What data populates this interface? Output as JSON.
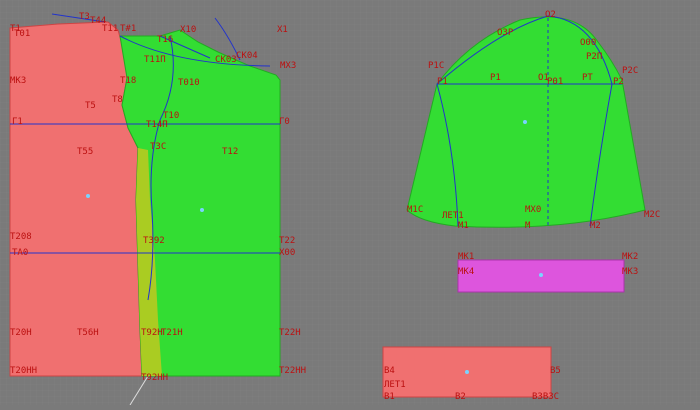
{
  "colors": {
    "background": "#7a7a7a",
    "grid": "#828282",
    "back_piece": "#f07070",
    "front_piece": "#33dd33",
    "front_overlap": "#aacc22",
    "sleeve_piece": "#33dd33",
    "cuff_piece": "#dd55dd",
    "band_piece": "#f07070",
    "construction_line": "#2233cc",
    "label": "#bb1111",
    "marker": "#7ad3ff"
  },
  "labels": {
    "t1": "T1",
    "t3": "T3",
    "t44": "T44",
    "t01": "T01",
    "t11": "T11",
    "x_t1": "T#1",
    "x1": "X1",
    "x10": "X10",
    "t16": "T16",
    "t11p": "T11П",
    "ck04": "CK04",
    "ck03": "CK03",
    "mx3": "MX3",
    "t18": "T18",
    "t010": "T010",
    "t8": "T8",
    "t5": "T5",
    "t10": "T10",
    "g1": "Г1",
    "t14p": "T14П",
    "g0": "Г0",
    "t3c": "T3C",
    "t55": "T55",
    "t12": "T12",
    "t208": "T208",
    "t392": "T392",
    "t22": "T22",
    "ta0": "TA0",
    "x00": "X00",
    "t22h": "T22H",
    "t20h": "T20H",
    "t56h": "T56H",
    "t92h": "T92H",
    "t21h": "T21H",
    "t20hh": "T20HH",
    "t92hh": "T92HH",
    "t22hh": "T22HH",
    "o2": "O2",
    "o3p": "O3P",
    "o00": "O00",
    "p2p": "P2П",
    "p1c": "P1C",
    "p2c": "P2C",
    "p1": "P1",
    "o1": "O1",
    "p01": "P01",
    "pt": "PT",
    "p2": "P2",
    "m1c": "M1C",
    "let1": "ЛЕТ1",
    "mx0": "MX0",
    "m2c": "M2C",
    "m1": "M1",
    "m": "M",
    "m2": "M2",
    "mk1": "MK1",
    "mk2": "MK2",
    "mk4": "MK4",
    "mk3": "MK3",
    "b4": "B4",
    "b5": "B5",
    "let1b": "ЛЕТ1",
    "b1": "B1",
    "b2": "B2",
    "b3b3c": "B3B3C"
  }
}
